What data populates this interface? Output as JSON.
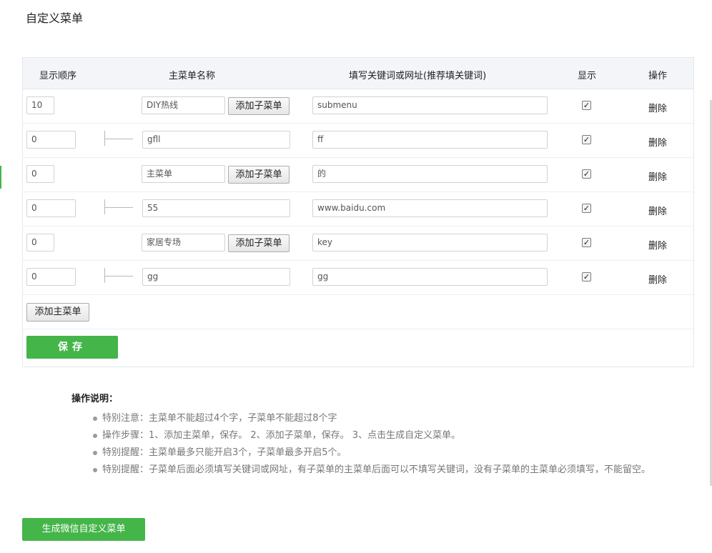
{
  "page": {
    "title": "自定义菜单"
  },
  "table": {
    "headers": {
      "order": "显示顺序",
      "name": "主菜单名称",
      "keyword": "填写关键词或网址(推荐填关键词)",
      "show": "显示",
      "action": "操作"
    },
    "rows": [
      {
        "type": "main",
        "order": "10",
        "name": "DIY热线",
        "keyword": "submenu",
        "show": true,
        "add_sub_label": "添加子菜单",
        "delete_label": "删除"
      },
      {
        "type": "sub",
        "order": "0",
        "name": "gfll",
        "keyword": "ff",
        "show": true,
        "delete_label": "删除"
      },
      {
        "type": "main",
        "order": "0",
        "name": "主菜单",
        "keyword": "的",
        "show": true,
        "add_sub_label": "添加子菜单",
        "delete_label": "删除"
      },
      {
        "type": "sub",
        "order": "0",
        "name": "55",
        "keyword": "www.baidu.com",
        "show": true,
        "delete_label": "删除"
      },
      {
        "type": "main",
        "order": "0",
        "name": "家居专场",
        "keyword": "key",
        "show": true,
        "add_sub_label": "添加子菜单",
        "delete_label": "删除"
      },
      {
        "type": "sub",
        "order": "0",
        "name": "gg",
        "keyword": "gg",
        "show": true,
        "delete_label": "删除"
      }
    ],
    "add_main_label": "添加主菜单",
    "save_label": "保存"
  },
  "notes": {
    "title": "操作说明：",
    "items": [
      "特别注意：主菜单不能超过4个字，子菜单不能超过8个字",
      "操作步骤：1、添加主菜单，保存。    2、添加子菜单，保存。    3、点击生成自定义菜单。",
      "特别提醒：主菜单最多只能开启3个，子菜单最多开启5个。",
      "特别提醒：子菜单后面必须填写关键词或网址，有子菜单的主菜单后面可以不填写关键词，没有子菜单的主菜单必须填写，不能留空。"
    ]
  },
  "generate_label": "生成微信自定义菜单",
  "colors": {
    "accent": "#44b549",
    "header_bg": "#f4f5f9",
    "border": "#e4e8eb"
  }
}
